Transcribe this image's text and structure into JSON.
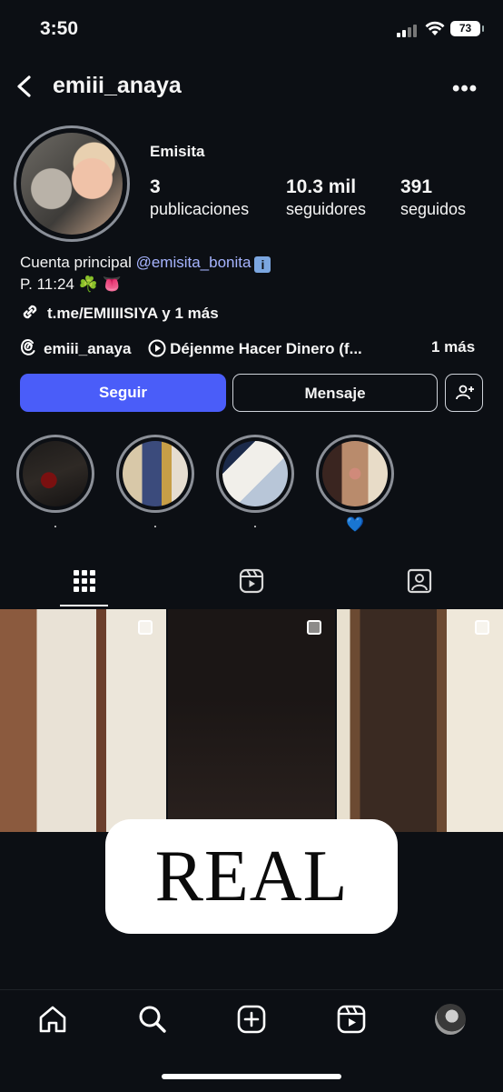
{
  "status_bar": {
    "time": "3:50",
    "battery": "73"
  },
  "header": {
    "username": "emiii_anaya"
  },
  "profile": {
    "display_name": "Emisita",
    "stats": [
      {
        "value": "3",
        "label": "publicaciones"
      },
      {
        "value": "10.3 mil",
        "label": "seguidores"
      },
      {
        "value": "391",
        "label": "seguidos"
      }
    ],
    "bio_line1_prefix": "Cuenta principal ",
    "bio_mention": "@emisita_bonita",
    "bio_line2": "P. 11:24 ☘️ 👅",
    "link": "t.me/EMIIIISIYA y 1 más",
    "threads_handle": "emiii_anaya",
    "music": "Déjenme Hacer Dinero (f...",
    "music_more": "1 más"
  },
  "buttons": {
    "follow": "Seguir",
    "message": "Mensaje"
  },
  "highlights": [
    {
      "label": "."
    },
    {
      "label": "."
    },
    {
      "label": "."
    },
    {
      "label": "💙"
    }
  ],
  "overlay": {
    "text": "REAL"
  },
  "icons": [
    "back-icon",
    "more-icon",
    "info-icon",
    "link-icon",
    "threads-icon",
    "play-circle-icon",
    "add-user-icon",
    "grid-icon",
    "reels-icon",
    "tagged-icon",
    "home-icon",
    "search-icon",
    "create-icon",
    "reels-nav-icon",
    "profile-avatar-icon"
  ],
  "colors": {
    "accent": "#4a5df9",
    "mention": "#a6b4ff",
    "background": "#0c0f14"
  }
}
